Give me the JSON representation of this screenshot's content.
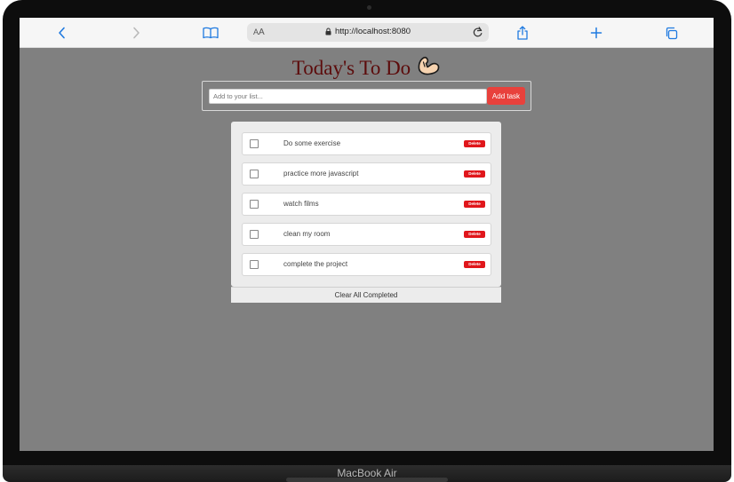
{
  "device": {
    "label": "MacBook Air"
  },
  "browser": {
    "text_size_label_small": "A",
    "text_size_label_large": "A",
    "url": "http://localhost:8080",
    "icons": [
      "back-icon",
      "forward-icon",
      "bookmarks-icon",
      "text-size-icon",
      "lock-icon",
      "reload-icon",
      "share-icon",
      "new-tab-icon",
      "tabs-icon"
    ]
  },
  "app": {
    "title": "Today's To Do",
    "title_icon": "flexed-biceps-icon",
    "input_placeholder": "Add to your list...",
    "add_button": "Add task",
    "tasks": [
      {
        "text": "Do some exercise",
        "delete_label": "Delete",
        "completed": false
      },
      {
        "text": "practice more javascript",
        "delete_label": "Delete",
        "completed": false
      },
      {
        "text": "watch films",
        "delete_label": "Delete",
        "completed": false
      },
      {
        "text": "clean my room",
        "delete_label": "Delete",
        "completed": false
      },
      {
        "text": "complete the project",
        "delete_label": "Delete",
        "completed": false
      }
    ],
    "clear_button": "Clear All Completed"
  },
  "colors": {
    "page_background": "#808080",
    "title": "#5c0b0b",
    "add_button": "#e8413c",
    "delete_button": "#e0161b",
    "browser_accent": "#1f7ae0"
  }
}
